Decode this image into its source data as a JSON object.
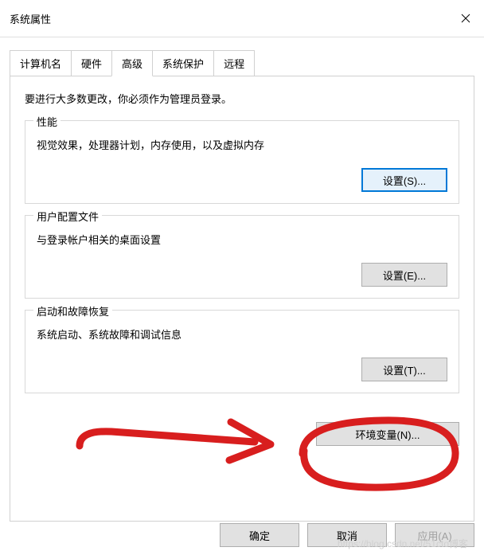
{
  "window": {
    "title": "系统属性"
  },
  "tabs": {
    "computer_name": "计算机名",
    "hardware": "硬件",
    "advanced": "高级",
    "system_protection": "系统保护",
    "remote": "远程"
  },
  "content": {
    "intro": "要进行大多数更改，你必须作为管理员登录。"
  },
  "performance": {
    "title": "性能",
    "desc": "视觉效果，处理器计划，内存使用，以及虚拟内存",
    "button": "设置(S)..."
  },
  "user_profiles": {
    "title": "用户配置文件",
    "desc": "与登录帐户相关的桌面设置",
    "button": "设置(E)..."
  },
  "startup": {
    "title": "启动和故障恢复",
    "desc": "系统启动、系统故障和调试信息",
    "button": "设置(T)..."
  },
  "env_vars": {
    "button": "环境变量(N)..."
  },
  "dialog": {
    "ok": "确定",
    "cancel": "取消",
    "apply": "应用(A)"
  },
  "watermark": "https://blog.csdn.net/51cto博客"
}
